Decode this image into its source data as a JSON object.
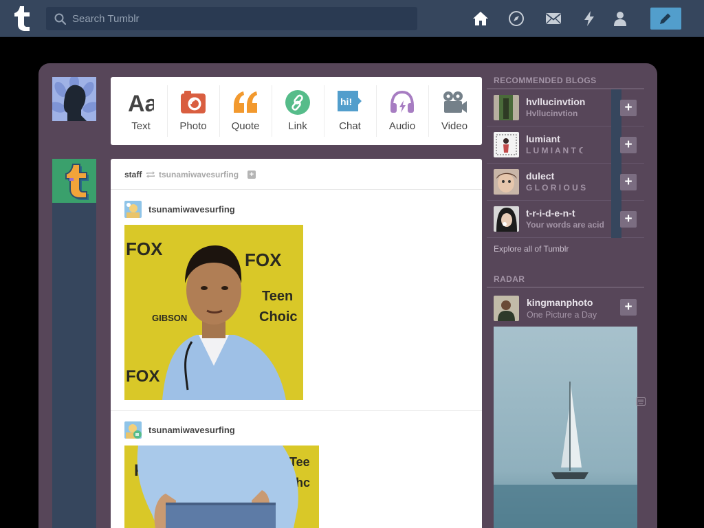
{
  "topbar": {
    "search_placeholder": "Search Tumblr",
    "icons": [
      "home-icon",
      "explore-icon",
      "inbox-icon",
      "activity-icon",
      "account-icon",
      "compose-icon"
    ]
  },
  "post_types": [
    {
      "label": "Text",
      "icon": "text-icon",
      "color": "#444444"
    },
    {
      "label": "Photo",
      "icon": "photo-icon",
      "color": "#d95e40"
    },
    {
      "label": "Quote",
      "icon": "quote-icon",
      "color": "#f2992e"
    },
    {
      "label": "Link",
      "icon": "link-icon",
      "color": "#56bc8a"
    },
    {
      "label": "Chat",
      "icon": "chat-icon",
      "color": "#529ecc"
    },
    {
      "label": "Audio",
      "icon": "audio-icon",
      "color": "#a77dc2"
    },
    {
      "label": "Video",
      "icon": "video-icon",
      "color": "#748089"
    }
  ],
  "post": {
    "poster": "staff",
    "source": "tsunamiwavesurfing",
    "entries": [
      {
        "username": "tsunamiwavesurfing"
      },
      {
        "username": "tsunamiwavesurfing"
      }
    ]
  },
  "sidebar": {
    "recommended_heading": "RECOMMENDED BLOGS",
    "recommended": [
      {
        "name": "hvllucinvtion",
        "title": "Hvllucinvtion"
      },
      {
        "name": "lumiant",
        "title": "L U M I A N T ☾"
      },
      {
        "name": "dulect",
        "title": "G L O R I O U S"
      },
      {
        "name": "t-r-i-d-e-n-t",
        "title": "Your words are acid"
      }
    ],
    "explore": "Explore all of Tumblr",
    "radar_heading": "RADAR",
    "radar": {
      "name": "kingmanphoto",
      "title": "One Picture a Day"
    }
  },
  "colors": {
    "topbar": "#36465d",
    "dashboard": "#574659",
    "accent": "#529ecc"
  }
}
